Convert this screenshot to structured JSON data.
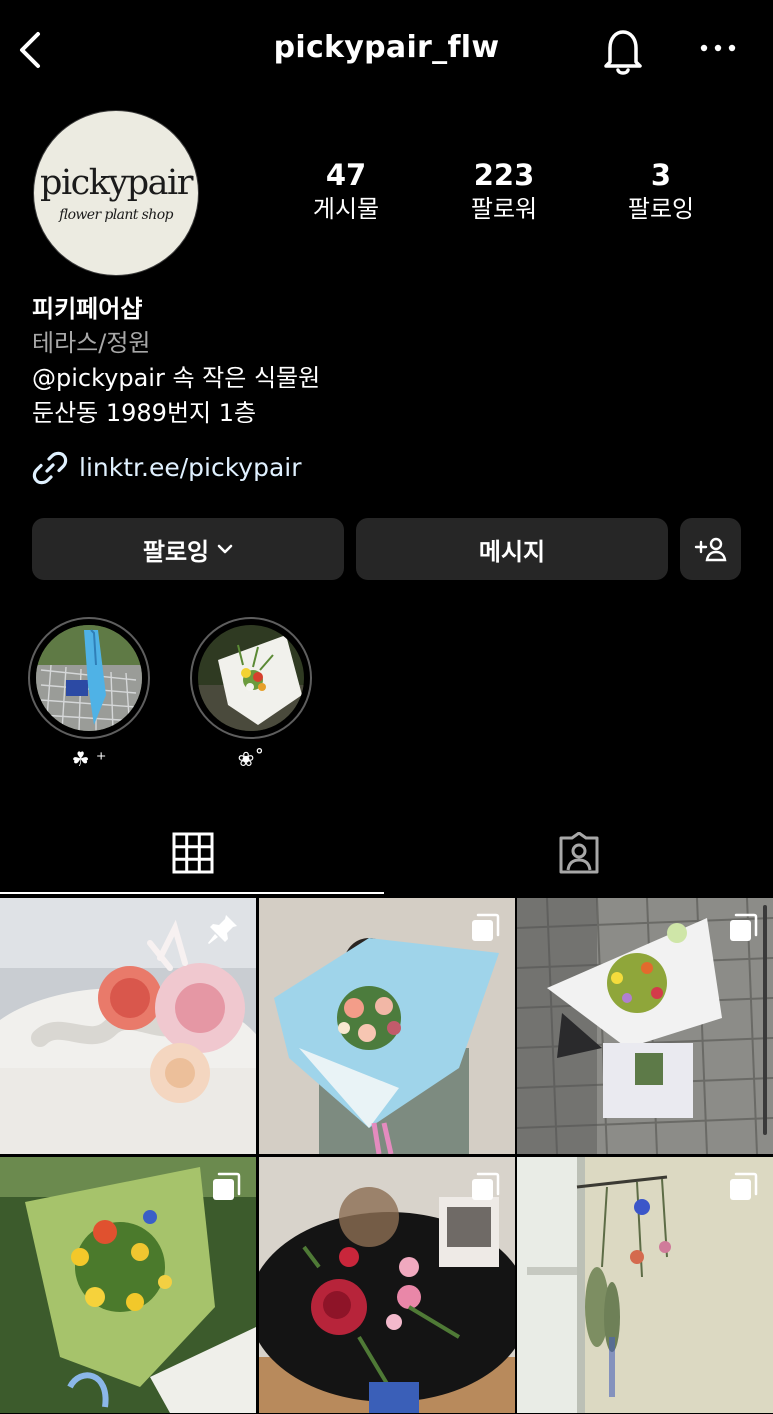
{
  "header": {
    "username": "pickypair_flw"
  },
  "profile": {
    "avatar": {
      "logo_main": "pickypair",
      "logo_sub": "flower plant shop"
    },
    "stats": [
      {
        "value": "47",
        "label": "게시물"
      },
      {
        "value": "223",
        "label": "팔로워"
      },
      {
        "value": "3",
        "label": "팔로잉"
      }
    ],
    "name": "피키페어샵",
    "category": "테라스/정원",
    "bio_lines": [
      "@pickypair 속 작은 식물원",
      "둔산동 1989번지 1층"
    ],
    "link": "linktr.ee/pickypair"
  },
  "actions": {
    "follow_label": "팔로잉",
    "message_label": "메시지"
  },
  "highlights": [
    {
      "label": "☘︎ ⁺"
    },
    {
      "label": "❀˚"
    }
  ],
  "tabs": {
    "active": "grid"
  },
  "posts": [
    {
      "type": "pinned",
      "subject": "flower cake"
    },
    {
      "type": "carousel",
      "subject": "blue bouquet"
    },
    {
      "type": "carousel",
      "subject": "bouquet in bag"
    },
    {
      "type": "carousel",
      "subject": "green wrapped bouquet"
    },
    {
      "type": "carousel",
      "subject": "black wrapped bouquet"
    },
    {
      "type": "carousel",
      "subject": "dried flowers by window"
    }
  ],
  "colors": {
    "background": "#000000",
    "button_bg": "#262626",
    "link": "#e0f1ff",
    "category": "#a8a8a8"
  }
}
